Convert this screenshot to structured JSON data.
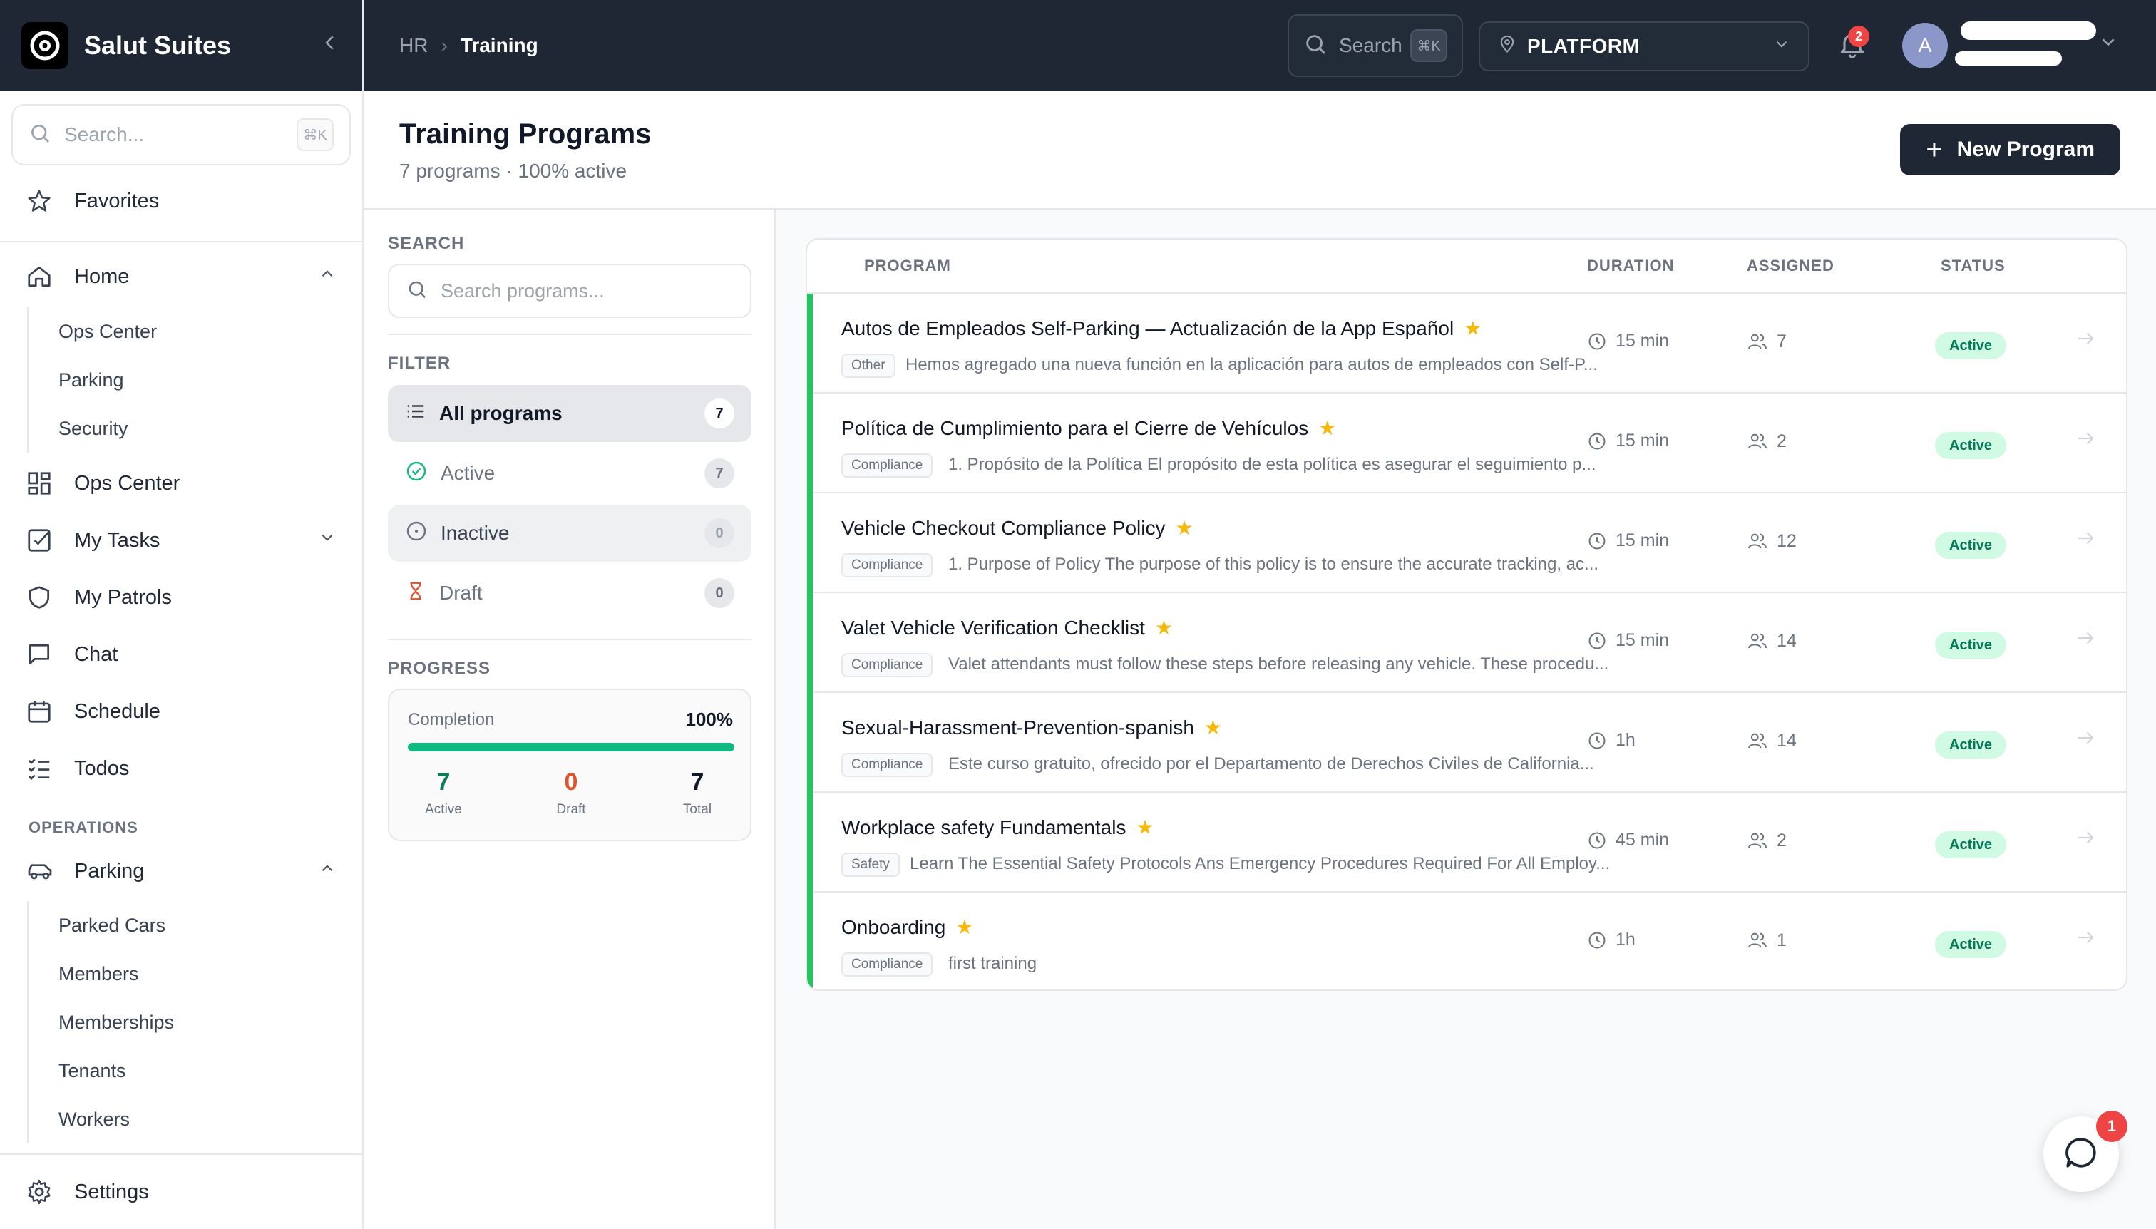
{
  "app": {
    "name": "Salut Suites"
  },
  "sidebar": {
    "search_placeholder": "Search...",
    "search_shortcut": "⌘K",
    "favorites": "Favorites",
    "home": {
      "label": "Home",
      "children": [
        "Ops Center",
        "Parking",
        "Security"
      ]
    },
    "items": [
      "Ops Center",
      "My Tasks",
      "My Patrols",
      "Chat",
      "Schedule",
      "Todos"
    ],
    "operations_label": "OPERATIONS",
    "parking": {
      "label": "Parking",
      "children": [
        "Parked Cars",
        "Members",
        "Memberships",
        "Tenants",
        "Workers"
      ]
    },
    "settings": "Settings"
  },
  "header": {
    "breadcrumb": [
      "HR",
      "Training"
    ],
    "search_label": "Search",
    "search_shortcut": "⌘K",
    "location": "PLATFORM",
    "notification_count": "2",
    "avatar_initial": "A"
  },
  "page": {
    "title": "Training Programs",
    "subtitle": "7 programs · 100% active",
    "new_button": "New Program"
  },
  "filters": {
    "search_label": "SEARCH",
    "search_placeholder": "Search programs...",
    "filter_label": "FILTER",
    "options": [
      {
        "label": "All programs",
        "count": "7"
      },
      {
        "label": "Active",
        "count": "7"
      },
      {
        "label": "Inactive",
        "count": "0"
      },
      {
        "label": "Draft",
        "count": "0"
      }
    ],
    "progress_label": "PROGRESS",
    "progress": {
      "label": "Completion",
      "value_text": "100%",
      "fraction": 1.0,
      "stats": [
        {
          "value": "7",
          "label": "Active",
          "color": "#0f7a5a"
        },
        {
          "value": "0",
          "label": "Draft",
          "color": "#e0522b"
        },
        {
          "value": "7",
          "label": "Total",
          "color": "#111827"
        }
      ]
    }
  },
  "table": {
    "columns": [
      "PROGRAM",
      "DURATION",
      "ASSIGNED",
      "STATUS"
    ],
    "rows": [
      {
        "title": "Autos de Empleados Self-Parking — Actualización de la App Español",
        "tag": "Other",
        "desc": "Hemos agregado una nueva función en la aplicación para autos de empleados con Self-P...",
        "duration": "15 min",
        "assigned": "7",
        "status": "Active"
      },
      {
        "title": "Política de Cumplimiento para el Cierre de Vehículos",
        "tag": "Compliance",
        "desc": "1. Propósito de la Política El propósito de esta política es asegurar el seguimiento p...",
        "duration": "15 min",
        "assigned": "2",
        "status": "Active"
      },
      {
        "title": "Vehicle Checkout Compliance Policy",
        "tag": "Compliance",
        "desc": "1. Purpose of Policy The purpose of this policy is to ensure the accurate tracking, ac...",
        "duration": "15 min",
        "assigned": "12",
        "status": "Active"
      },
      {
        "title": "Valet Vehicle Verification Checklist",
        "tag": "Compliance",
        "desc": "Valet attendants must follow these steps before releasing any vehicle. These procedu...",
        "duration": "15 min",
        "assigned": "14",
        "status": "Active"
      },
      {
        "title": "Sexual-Harassment-Prevention-spanish",
        "tag": "Compliance",
        "desc": "Este curso gratuito, ofrecido por el Departamento de Derechos Civiles de California...",
        "duration": "1h",
        "assigned": "14",
        "status": "Active"
      },
      {
        "title": "Workplace safety Fundamentals",
        "tag": "Safety",
        "desc": "Learn The Essential Safety Protocols Ans Emergency Procedures Required For All Employ...",
        "duration": "45 min",
        "assigned": "2",
        "status": "Active"
      },
      {
        "title": "Onboarding",
        "tag": "Compliance",
        "desc": "first training",
        "duration": "1h",
        "assigned": "1",
        "status": "Active"
      }
    ]
  },
  "chat": {
    "badge": "1"
  }
}
